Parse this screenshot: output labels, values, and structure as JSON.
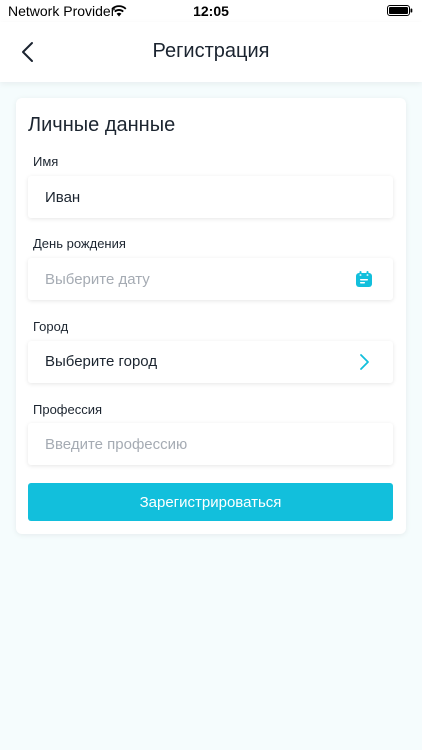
{
  "status_bar": {
    "carrier": "Network Provider",
    "time": "12:05"
  },
  "navbar": {
    "title": "Регистрация",
    "back_icon": "chevron-left-icon"
  },
  "form": {
    "section_title": "Личные данные",
    "name": {
      "label": "Имя",
      "value": "Иван"
    },
    "birthday": {
      "label": "День рождения",
      "placeholder": "Выберите дату",
      "icon": "calendar-icon"
    },
    "city": {
      "label": "Город",
      "value": "Выберите город",
      "icon": "chevron-right-icon"
    },
    "profession": {
      "label": "Профессия",
      "placeholder": "Введите профессию"
    },
    "submit_label": "Зарегистрироваться"
  },
  "colors": {
    "accent": "#12bfdc",
    "background": "#f5fcfd",
    "text": "#1c2530",
    "placeholder": "#a5abb3"
  }
}
